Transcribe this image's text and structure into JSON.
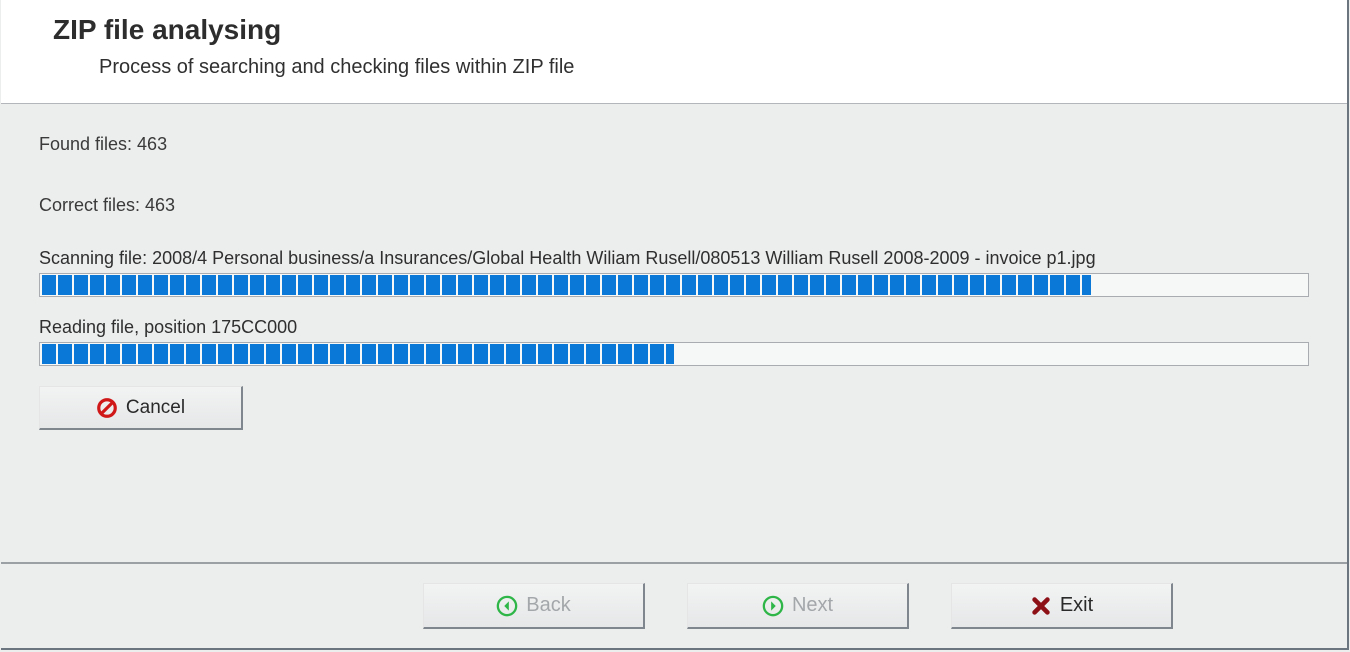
{
  "header": {
    "title": "ZIP file analysing",
    "subtitle": "Process of searching and checking files within ZIP file"
  },
  "status": {
    "found_label": "Found files: 463",
    "correct_label": "Correct files: 463",
    "scanning_label": "Scanning file: 2008/4 Personal business/a Insurances/Global Health Wiliam Rusell/080513 William Rusell 2008-2009 - invoice p1.jpg",
    "scanning_percent": 83,
    "reading_label": "Reading file, position 175CC000",
    "reading_percent": 50
  },
  "buttons": {
    "cancel": "Cancel",
    "back": "Back",
    "next": "Next",
    "exit": "Exit"
  },
  "colors": {
    "progress_active": "#0a78d6",
    "nav_green": "#2fb648",
    "exit_red": "#8d1016"
  }
}
